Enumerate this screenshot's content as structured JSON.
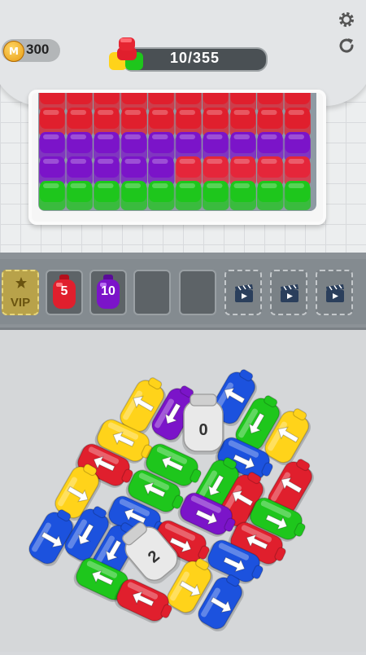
{
  "header": {
    "coins": "300",
    "coin_symbol": "M",
    "progress": "10/355",
    "progress_fraction": 0.028
  },
  "icons": {
    "settings": "gear-icon",
    "restart": "restart-icon"
  },
  "colors": {
    "red": "#e01f2d",
    "purple": "#7b14c9",
    "green": "#1ec61c",
    "yellow": "#ffd31a",
    "blue": "#1c52de",
    "white": "#e9e9e9"
  },
  "tray_rows": [
    "red",
    "red",
    "purple",
    "purple-red",
    "green"
  ],
  "slots": [
    {
      "type": "vip",
      "label": "VIP"
    },
    {
      "type": "jar",
      "color": "red",
      "count": "5"
    },
    {
      "type": "jar",
      "color": "purple",
      "count": "10"
    },
    {
      "type": "empty"
    },
    {
      "type": "empty"
    },
    {
      "type": "ad"
    },
    {
      "type": "ad"
    },
    {
      "type": "ad"
    }
  ],
  "board_counts": {
    "white_top": "0",
    "white_bottom": "2"
  }
}
